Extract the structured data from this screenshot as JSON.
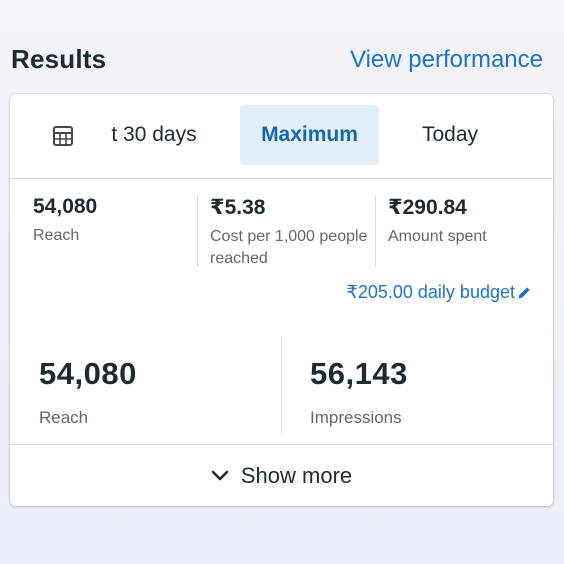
{
  "header": {
    "title": "Results",
    "view_link": "View performance"
  },
  "tabs": [
    {
      "label": "t 30 days",
      "selected": false
    },
    {
      "label": "Maximum",
      "selected": true
    },
    {
      "label": "Today",
      "selected": false
    }
  ],
  "summary": [
    {
      "value": "54,080",
      "label": "Reach"
    },
    {
      "value": "₹5.38",
      "label": "Cost per 1,000 people reached"
    },
    {
      "value": "₹290.84",
      "label": "Amount spent"
    }
  ],
  "budget": {
    "text": "₹205.00 daily budget",
    "icon": "pencil-icon"
  },
  "metrics": [
    {
      "value": "54,080",
      "label": "Reach"
    },
    {
      "value": "56,143",
      "label": "Impressions"
    }
  ],
  "show_more": {
    "label": "Show more",
    "icon": "chevron-down-icon"
  },
  "colors": {
    "link": "#1b74c5",
    "selected_tab_bg": "#e2eef8",
    "selected_tab_text": "#1669a8",
    "primary_text": "#1c2b33",
    "secondary_text": "#606770"
  }
}
